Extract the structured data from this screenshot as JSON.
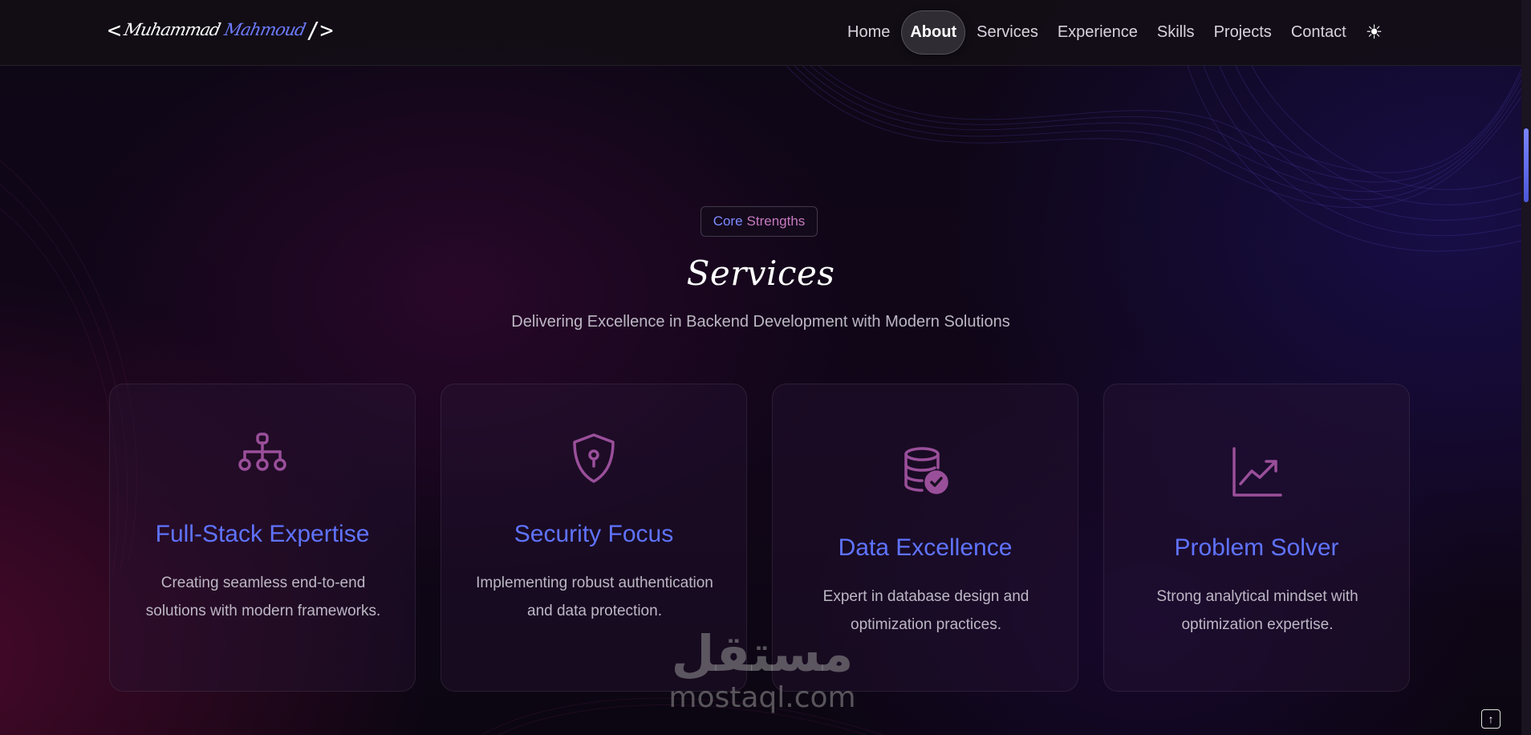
{
  "nav": {
    "logo_open": "<",
    "logo_first": "Muhammad",
    "logo_second": "Mahmoud",
    "logo_close": "/>",
    "items": [
      "Home",
      "About",
      "Services",
      "Experience",
      "Skills",
      "Projects",
      "Contact"
    ],
    "active": "About",
    "theme_icon": "sun-icon",
    "theme_glyph": "☀"
  },
  "section": {
    "badge_part1": "Core",
    "badge_part2": "Strengths",
    "title": "Services",
    "subtitle": "Delivering Excellence in Backend Development with Modern Solutions"
  },
  "cards": [
    {
      "icon": "sitemap-icon",
      "title": "Full-Stack Expertise",
      "desc": "Creating seamless end-to-end solutions with modern frameworks."
    },
    {
      "icon": "shield-lock-icon",
      "title": "Security Focus",
      "desc": "Implementing robust authentication and data protection."
    },
    {
      "icon": "database-check-icon",
      "title": "Data Excellence",
      "desc": "Expert in database design and optimization practices."
    },
    {
      "icon": "chart-line-icon",
      "title": "Problem Solver",
      "desc": "Strong analytical mindset with optimization expertise."
    }
  ],
  "watermark": {
    "arabic": "مستقل",
    "latin": "mostaql.com"
  },
  "colors": {
    "accent": "#5f73ff",
    "icon": "#9a4f9a",
    "badge_core": "#7e8bff",
    "badge_strengths": "#c77abf"
  },
  "scroll_top_glyph": "↑"
}
